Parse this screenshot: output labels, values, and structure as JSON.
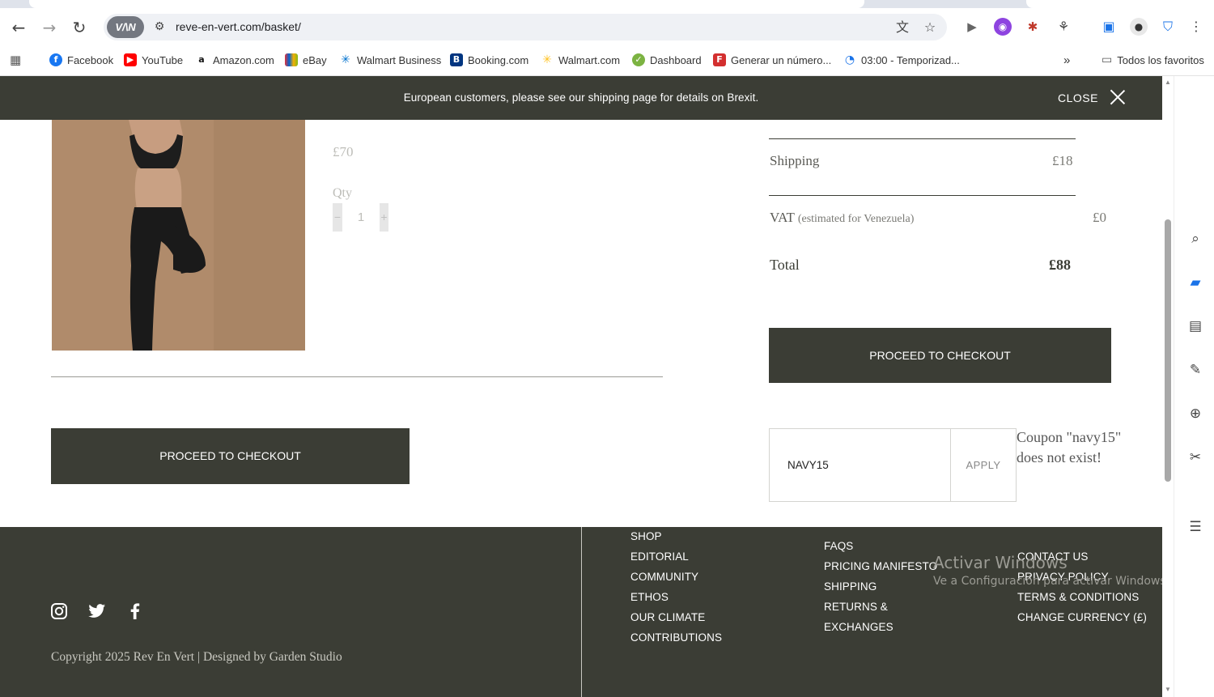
{
  "browser": {
    "url": "reve-en-vert.com/basket/",
    "vpn_label": "V/\\N",
    "bookmarks": [
      {
        "label": "Facebook",
        "icon": "facebook-icon",
        "color": "#1877f2"
      },
      {
        "label": "YouTube",
        "icon": "youtube-icon",
        "color": "#ff0000"
      },
      {
        "label": "Amazon.com",
        "icon": "amazon-icon",
        "color": "#111111"
      },
      {
        "label": "eBay",
        "icon": "ebay-icon",
        "color": "#e53238"
      },
      {
        "label": "Walmart Business",
        "icon": "walmart-business-icon",
        "color": "#0071ce"
      },
      {
        "label": "Booking.com",
        "icon": "booking-icon",
        "color": "#003580"
      },
      {
        "label": "Walmart.com",
        "icon": "walmart-icon",
        "color": "#ffc220"
      },
      {
        "label": "Dashboard",
        "icon": "dashboard-icon",
        "color": "#2e7d32"
      },
      {
        "label": "Generar un número...",
        "icon": "generator-icon",
        "color": "#d32f2f"
      },
      {
        "label": "03:00 - Temporizad...",
        "icon": "timer-icon",
        "color": "#1a73e8"
      }
    ],
    "more_bookmarks": "»",
    "all_favorites": "Todos los favoritos"
  },
  "banner": {
    "text": "European customers, please see our shipping page for details on Brexit.",
    "close_label": "CLOSE"
  },
  "basket": {
    "item_price": "£70",
    "qty_label": "Qty",
    "qty_value": "1",
    "qty_minus": "−",
    "qty_plus": "+",
    "checkout_label": "PROCEED TO CHECKOUT"
  },
  "summary": {
    "shipping_label": "Shipping",
    "shipping_value": "£18",
    "vat_label": "VAT",
    "vat_note": "(estimated for Venezuela)",
    "vat_value": "£0",
    "total_label": "Total",
    "total_value": "£88",
    "checkout_label": "PROCEED TO CHECKOUT"
  },
  "coupon": {
    "value": "NAVY15",
    "apply_label": "APPLY",
    "message": "Coupon \"navy15\" does not exist!"
  },
  "footer": {
    "copyright": "Copyright 2025 Rev En Vert | Designed by Garden Studio",
    "col1": [
      "SHOP",
      "EDITORIAL",
      "COMMUNITY",
      "ETHOS",
      "OUR CLIMATE",
      "CONTRIBUTIONS"
    ],
    "col2": [
      "FAQS",
      "PRICING MANIFESTO",
      "SHIPPING",
      "RETURNS &",
      "EXCHANGES"
    ],
    "col3": [
      "CONTACT US",
      "PRIVACY POLICY",
      "TERMS & CONDITIONS",
      "CHANGE CURRENCY (£)"
    ]
  },
  "windows_watermark": {
    "title": "Activar Windows",
    "subtitle": "Ve a Configuración para activar Windows."
  }
}
